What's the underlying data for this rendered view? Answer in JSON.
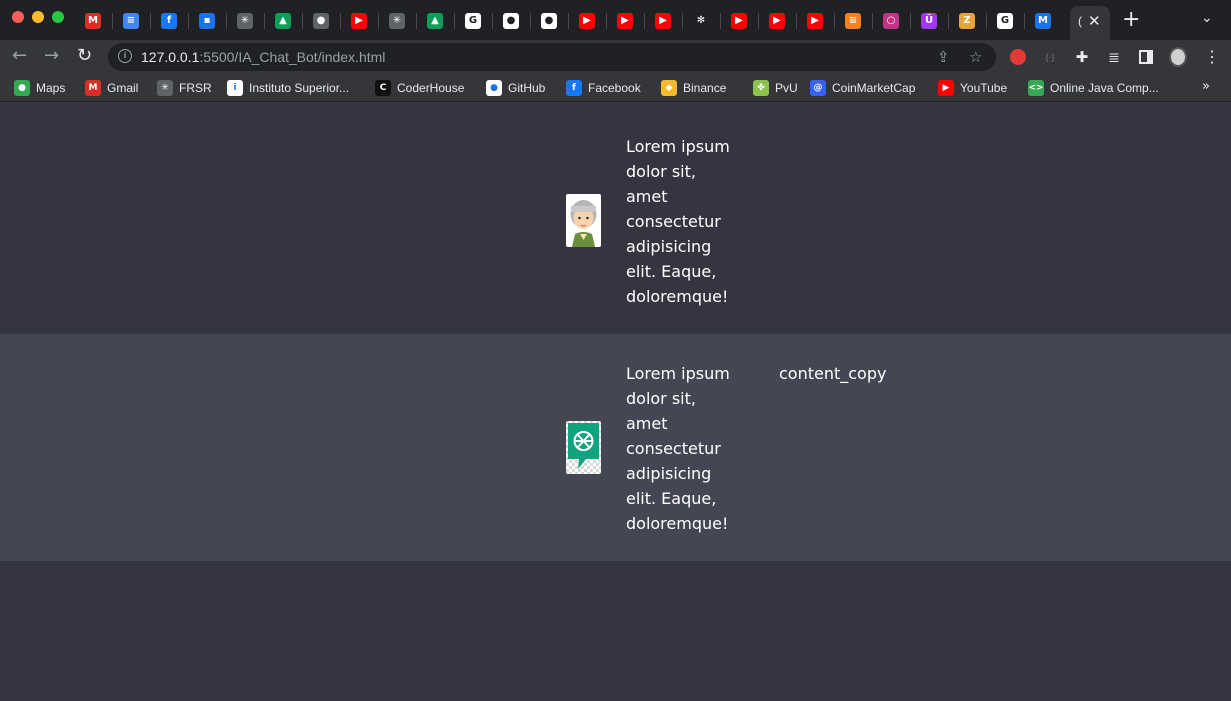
{
  "browser": {
    "active_tab_caption": "(",
    "url_host": "127.0.0.1",
    "url_rest": ":5500/IA_Chat_Bot/index.html",
    "tabs": [
      {
        "icon": "gmail-icon",
        "glyph": "M",
        "color": "#d93025"
      },
      {
        "icon": "docs-icon",
        "glyph": "≡",
        "color": "#4285f4"
      },
      {
        "icon": "facebook-icon",
        "glyph": "f",
        "color": "#1877f2"
      },
      {
        "icon": "meet-icon",
        "glyph": "▪",
        "color": "#1a73e8"
      },
      {
        "icon": "web-icon",
        "glyph": "✳",
        "color": "#5f6368"
      },
      {
        "icon": "drive-icon",
        "glyph": "▲",
        "color": "#0f9d58"
      },
      {
        "icon": "globe-icon",
        "glyph": "●",
        "color": "#5f6368"
      },
      {
        "icon": "youtube-icon",
        "glyph": "▶",
        "color": "#ff0000"
      },
      {
        "icon": "web-icon",
        "glyph": "✳",
        "color": "#5f6368"
      },
      {
        "icon": "drive-icon",
        "glyph": "▲",
        "color": "#0f9d58"
      },
      {
        "icon": "google-icon",
        "glyph": "G",
        "color": "#ffffff"
      },
      {
        "icon": "github-icon",
        "glyph": "●",
        "color": "#ffffff"
      },
      {
        "icon": "github-icon",
        "glyph": "●",
        "color": "#ffffff"
      },
      {
        "icon": "youtube-icon",
        "glyph": "▶",
        "color": "#ff0000"
      },
      {
        "icon": "youtube-icon",
        "glyph": "▶",
        "color": "#ff0000"
      },
      {
        "icon": "youtube-icon",
        "glyph": "▶",
        "color": "#ff0000"
      },
      {
        "icon": "openai-icon",
        "glyph": "✻",
        "color": "#202124"
      },
      {
        "icon": "youtube-icon",
        "glyph": "▶",
        "color": "#ff0000"
      },
      {
        "icon": "youtube-icon",
        "glyph": "▶",
        "color": "#ff0000"
      },
      {
        "icon": "youtube-icon",
        "glyph": "▶",
        "color": "#ff0000"
      },
      {
        "icon": "stackoverflow-icon",
        "glyph": "≡",
        "color": "#f48024"
      },
      {
        "icon": "circle-icon",
        "glyph": "○",
        "color": "#c13584"
      },
      {
        "icon": "udemy-icon",
        "glyph": "Ü",
        "color": "#a435f0"
      },
      {
        "icon": "zb-icon",
        "glyph": "Z",
        "color": "#e8a33d"
      },
      {
        "icon": "google-icon",
        "glyph": "G",
        "color": "#ffffff"
      },
      {
        "icon": "mj-icon",
        "glyph": "M",
        "color": "#1a73e8"
      }
    ]
  },
  "bookmarks": [
    {
      "label": "Maps",
      "icon": "maps-icon",
      "glyph": "●",
      "color": "#34a853"
    },
    {
      "label": "Gmail",
      "icon": "gmail-icon",
      "glyph": "M",
      "color": "#d93025"
    },
    {
      "label": "FRSR",
      "icon": "frsr-icon",
      "glyph": "✳",
      "color": "#5f6368"
    },
    {
      "label": "Instituto Superior...",
      "icon": "ispc-icon",
      "glyph": "i",
      "color": "#ffffff"
    },
    {
      "label": "CoderHouse",
      "icon": "coderhouse-icon",
      "glyph": "C",
      "color": "#111111"
    },
    {
      "label": "GitHub",
      "icon": "github-icon",
      "glyph": "●",
      "color": "#ffffff"
    },
    {
      "label": "Facebook",
      "icon": "facebook-icon",
      "glyph": "f",
      "color": "#1877f2"
    },
    {
      "label": "Binance",
      "icon": "binance-icon",
      "glyph": "◆",
      "color": "#f3ba2f"
    },
    {
      "label": "PvU",
      "icon": "pvu-icon",
      "glyph": "✤",
      "color": "#8bc34a"
    },
    {
      "label": "CoinMarketCap",
      "icon": "coinmarketcap-icon",
      "glyph": "@",
      "color": "#3861fb"
    },
    {
      "label": "YouTube",
      "icon": "youtube-icon",
      "glyph": "▶",
      "color": "#ff0000"
    },
    {
      "label": "Online Java Comp...",
      "icon": "code-icon",
      "glyph": "<>",
      "color": "#34a853"
    }
  ],
  "chat": {
    "user_message": "Lorem ipsum dolor sit, amet consectetur adipisicing elit. Eaque, doloremque!",
    "bot_message": "Lorem ipsum dolor sit, amet consectetur adipisicing elit. Eaque, doloremque!",
    "copy_label": "content_copy"
  }
}
